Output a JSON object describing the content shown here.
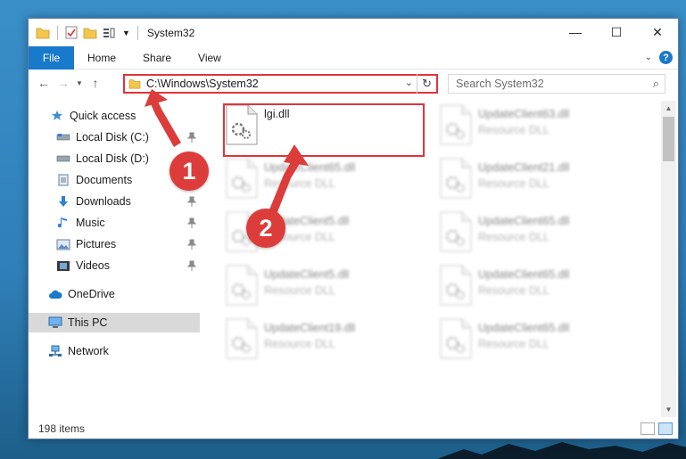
{
  "window": {
    "title": "System32",
    "controls": {
      "minimize": "—",
      "maximize": "☐",
      "close": "✕"
    }
  },
  "ribbon": {
    "tabs": [
      "File",
      "Home",
      "Share",
      "View"
    ],
    "help": "?"
  },
  "navigation": {
    "address": "C:\\Windows\\System32",
    "search_placeholder": "Search System32"
  },
  "sidebar": {
    "items": [
      {
        "label": "Quick access",
        "icon": "star-icon",
        "pinned": false
      },
      {
        "label": "Local Disk (C:)",
        "icon": "drive-icon",
        "pinned": true
      },
      {
        "label": "Local Disk (D:)",
        "icon": "drive-icon",
        "pinned": false
      },
      {
        "label": "Documents",
        "icon": "documents-icon",
        "pinned": true
      },
      {
        "label": "Downloads",
        "icon": "download-icon",
        "pinned": true
      },
      {
        "label": "Music",
        "icon": "music-icon",
        "pinned": true
      },
      {
        "label": "Pictures",
        "icon": "pictures-icon",
        "pinned": true
      },
      {
        "label": "Videos",
        "icon": "videos-icon",
        "pinned": true
      },
      {
        "label": "OneDrive",
        "icon": "cloud-icon",
        "pinned": false
      },
      {
        "label": "This PC",
        "icon": "pc-icon",
        "pinned": false,
        "selected": true
      },
      {
        "label": "Network",
        "icon": "network-icon",
        "pinned": false
      }
    ]
  },
  "files": [
    {
      "name": "lgi.dll",
      "type": "",
      "highlighted": true
    },
    {
      "name": "UpdateClient63.dll",
      "type": "Resource DLL"
    },
    {
      "name": "UpdateClient65.dll",
      "type": "Resource DLL"
    },
    {
      "name": "UpdateClient21.dll",
      "type": "Resource DLL"
    },
    {
      "name": "UpdateClient5.dll",
      "type": "Resource DLL"
    },
    {
      "name": "UpdateClient65.dll",
      "type": "Resource DLL"
    },
    {
      "name": "UpdateClient5.dll",
      "type": "Resource DLL"
    },
    {
      "name": "UpdateClient65.dll",
      "type": "Resource DLL"
    },
    {
      "name": "UpdateClient19.dll",
      "type": "Resource DLL"
    },
    {
      "name": "UpdateClient65.dll",
      "type": "Resource DLL"
    }
  ],
  "status": {
    "item_count": "198 items"
  },
  "annotations": {
    "step1": "1",
    "step2": "2",
    "color": "#dc3d3a"
  }
}
